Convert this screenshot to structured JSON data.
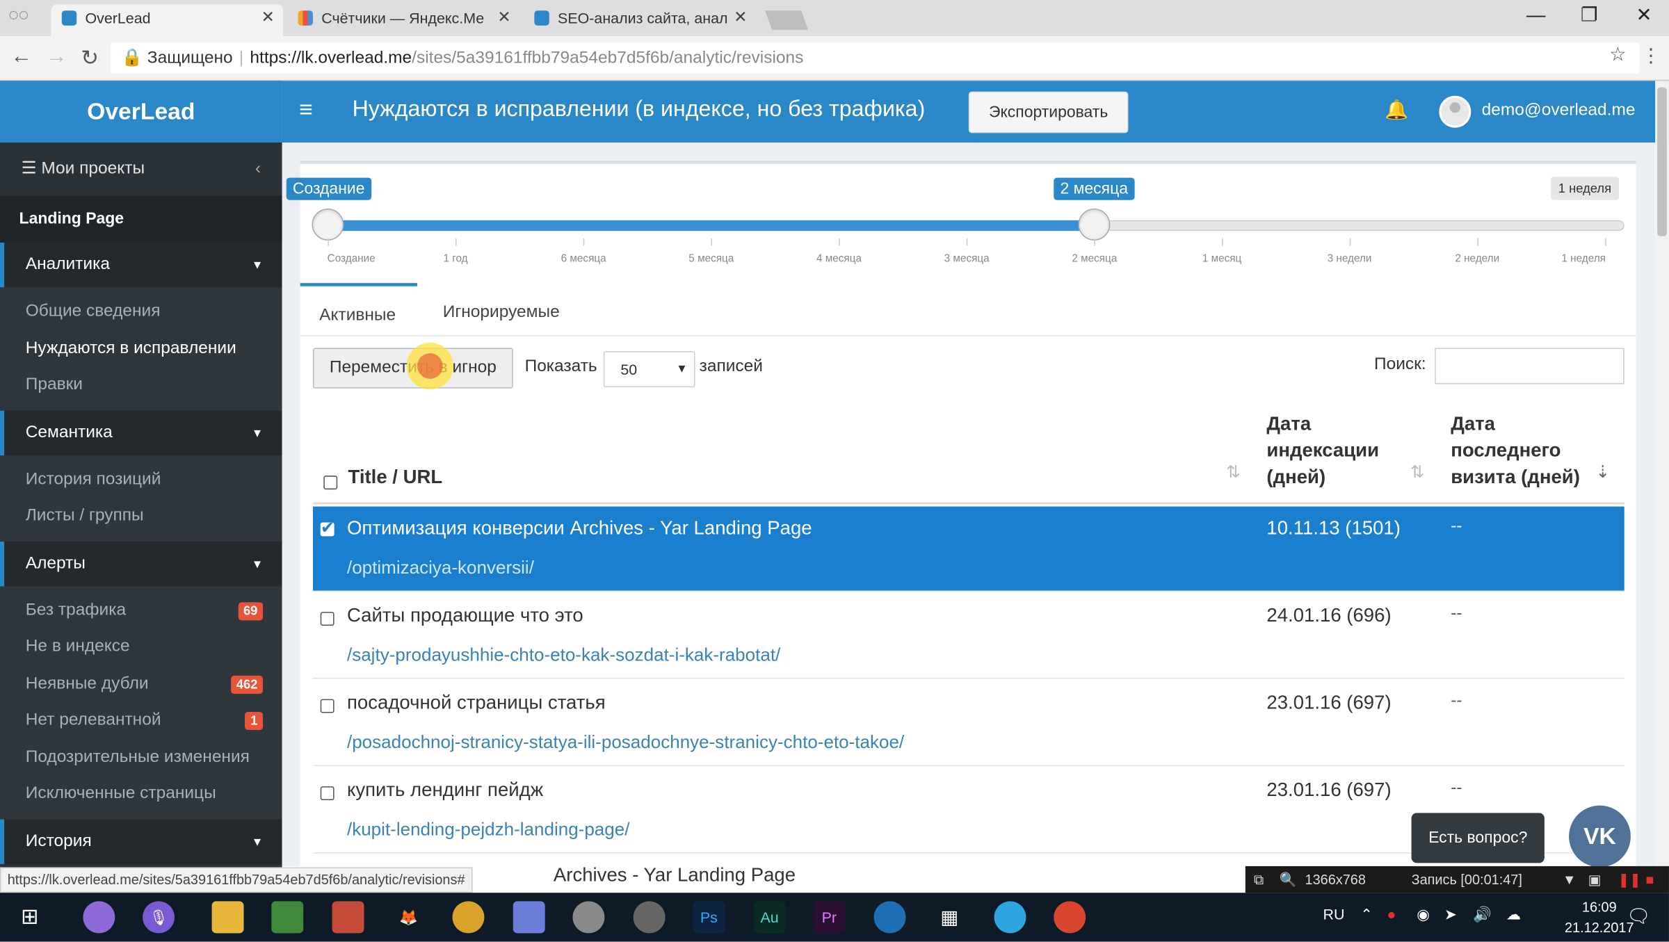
{
  "browser": {
    "tabs": [
      {
        "title": "OverLead",
        "active": true
      },
      {
        "title": "Счётчики — Яндекс.Ме",
        "active": false
      },
      {
        "title": "SEO-анализ сайта, анал",
        "active": false
      }
    ],
    "secure_label": "Защищено",
    "url_host": "https://lk.overlead.me",
    "url_path": "/sites/5a39161ffbb79a54eb7d5f6b/analytic/revisions",
    "status_url": "https://lk.overlead.me/sites/5a39161ffbb79a54eb7d5f6b/analytic/revisions#"
  },
  "sidebar": {
    "logo": "OverLead",
    "my_projects": "Мои проекты",
    "project_name": "Landing Page",
    "sections": [
      {
        "label": "Аналитика",
        "items": [
          {
            "label": "Общие сведения",
            "active": false
          },
          {
            "label": "Нуждаются в исправлении",
            "active": true
          },
          {
            "label": "Правки",
            "active": false
          }
        ]
      },
      {
        "label": "Семантика",
        "items": [
          {
            "label": "История позиций"
          },
          {
            "label": "Листы / группы"
          }
        ]
      },
      {
        "label": "Алерты",
        "items": [
          {
            "label": "Без трафика",
            "badge": "69"
          },
          {
            "label": "Не в индексе"
          },
          {
            "label": "Неявные дубли",
            "badge": "462"
          },
          {
            "label": "Нет релевантной",
            "badge": "1"
          },
          {
            "label": "Подозрительные изменения"
          },
          {
            "label": "Исключенные страницы"
          }
        ]
      },
      {
        "label": "История",
        "items": []
      }
    ]
  },
  "header": {
    "title": "Нуждаются в исправлении (в индексе, но без трафика)",
    "export_label": "Экспортировать",
    "user_email": "demo@overlead.me"
  },
  "slider": {
    "left_label": "Создание",
    "right_label": "2 месяца",
    "max_label": "1 неделя",
    "ticks": [
      "Создание",
      "1 год",
      "6 месяца",
      "5 месяца",
      "4 месяца",
      "3 месяца",
      "2 месяца",
      "1 месяц",
      "3 недели",
      "2 недели",
      "1 неделя"
    ],
    "selected_from_index": 0,
    "selected_to_index": 6
  },
  "content_tabs": [
    {
      "label": "Активные",
      "active": true
    },
    {
      "label": "Игнорируемые",
      "active": false
    }
  ],
  "toolbar": {
    "move_button": "Переместить в игнор",
    "show_label": "Показать",
    "page_size": "50",
    "records_label": "записей",
    "search_label": "Поиск:"
  },
  "table": {
    "col_title": "Title / URL",
    "col_date_lines": [
      "Дата",
      "индексации",
      "(дней)"
    ],
    "col_last_lines": [
      "Дата",
      "последнего",
      "визита (дней)"
    ],
    "rows": [
      {
        "title": "Оптимизация конверсии Archives - Yar Landing Page",
        "url": "/optimizaciya-konversii/",
        "date": "10.11.13 (1501)",
        "last": "--",
        "selected": true
      },
      {
        "title": "Сайты продающие что это",
        "url": "/sajty-prodayushhie-chto-eto-kak-sozdat-i-kak-rabotat/",
        "date": "24.01.16 (696)",
        "last": "--",
        "selected": false
      },
      {
        "title": "посадочной страницы статья",
        "url": "/posadochnoj-stranicy-statya-ili-posadochnye-stranicy-chto-eto-takoe/",
        "date": "23.01.16 (697)",
        "last": "--",
        "selected": false
      },
      {
        "title": "купить лендинг пейдж",
        "url": "/kupit-lending-pejdzh-landing-page/",
        "date": "23.01.16 (697)",
        "last": "--",
        "selected": false
      }
    ],
    "partial_row_title": "Archives - Yar Landing Page"
  },
  "chat": {
    "question": "Есть вопрос?",
    "vk": "VK"
  },
  "recorder": {
    "resolution": "1366x768",
    "recording": "Запись [00:01:47]"
  },
  "taskbar": {
    "lang": "RU",
    "time": "16:09",
    "date": "21.12.2017"
  }
}
